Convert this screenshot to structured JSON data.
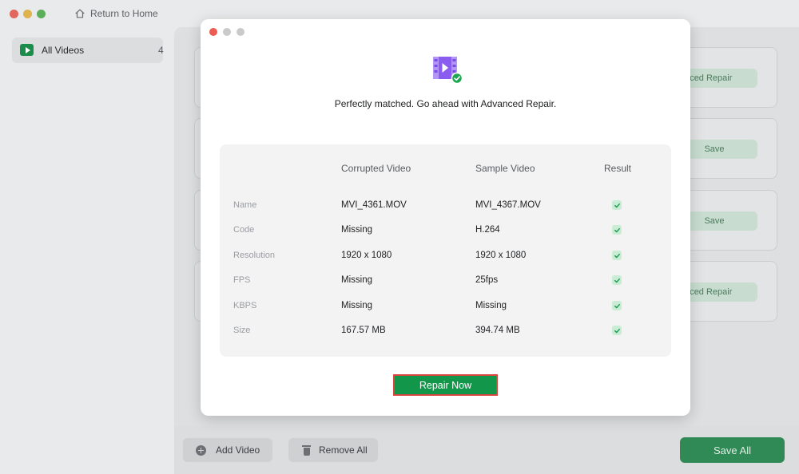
{
  "titlebar": {
    "home_label": "Return to Home"
  },
  "sidebar": {
    "items": [
      {
        "label": "All Videos",
        "count": "4",
        "icon": "play-icon"
      }
    ]
  },
  "cards": [
    {
      "button_label": "Advanced Repair"
    },
    {
      "button_label": "Save"
    },
    {
      "button_label": "Save"
    },
    {
      "button_label": "Advanced Repair"
    }
  ],
  "bottombar": {
    "add_label": "Add Video",
    "remove_label": "Remove All",
    "save_all_label": "Save All"
  },
  "modal": {
    "headline": "Perfectly matched. Go ahead with Advanced Repair.",
    "icon": "video-check-icon",
    "columns": {
      "corrupted": "Corrupted Video",
      "sample": "Sample Video",
      "result": "Result"
    },
    "rows": [
      {
        "label": "Name",
        "corrupted": "MVI_4361.MOV",
        "sample": "MVI_4367.MOV",
        "result": "check"
      },
      {
        "label": "Code",
        "corrupted": "Missing",
        "sample": "H.264",
        "result": "check"
      },
      {
        "label": "Resolution",
        "corrupted": "1920 x 1080",
        "sample": "1920 x 1080",
        "result": "check"
      },
      {
        "label": "FPS",
        "corrupted": "Missing",
        "sample": "25fps",
        "result": "check"
      },
      {
        "label": "KBPS",
        "corrupted": "Missing",
        "sample": "Missing",
        "result": "check"
      },
      {
        "label": "Size",
        "corrupted": "167.57 MB",
        "sample": "394.74 MB",
        "result": "check"
      }
    ],
    "repair_button": "Repair Now"
  },
  "colors": {
    "accent": "#12974a",
    "highlight_border": "#d9453f",
    "check_bg": "#c8ecd4",
    "check_mark": "#1e9b52"
  }
}
